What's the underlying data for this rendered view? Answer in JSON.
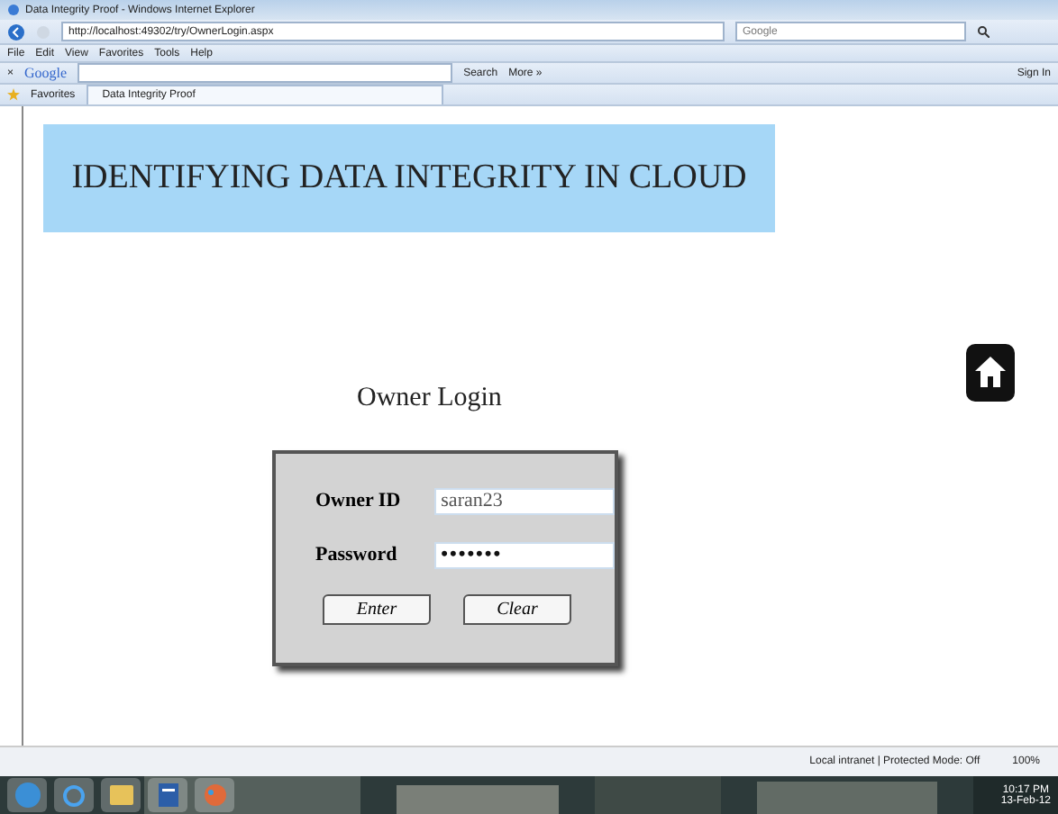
{
  "window": {
    "title": "Data Integrity Proof - Windows Internet Explorer"
  },
  "address_bar": {
    "url": "http://localhost:49302/try/OwnerLogin.aspx",
    "search_placeholder": "Google"
  },
  "menu": [
    "File",
    "Edit",
    "View",
    "Favorites",
    "Tools",
    "Help"
  ],
  "google_toolbar": {
    "close": "×",
    "logo": "Google",
    "search": "Search",
    "more": "More »",
    "sign_in": "Sign In"
  },
  "favorites_bar": {
    "label": "Favorites",
    "tabs": [
      {
        "label": "Data Integrity Proof",
        "selected": true
      }
    ]
  },
  "page": {
    "banner": "IDENTIFYING DATA INTEGRITY IN CLOUD",
    "heading": "Owner Login",
    "fields": [
      {
        "label": "Owner ID",
        "value": "saran23",
        "kind": "text"
      },
      {
        "label": "Password",
        "value": "•••••••",
        "kind": "password"
      }
    ],
    "buttons": [
      "Enter",
      "Clear"
    ]
  },
  "status_bar": {
    "zone": "Local intranet | Protected Mode: Off",
    "zoom": "100%"
  },
  "taskbar": {
    "time": "10:17 PM",
    "date": "13-Feb-12"
  }
}
